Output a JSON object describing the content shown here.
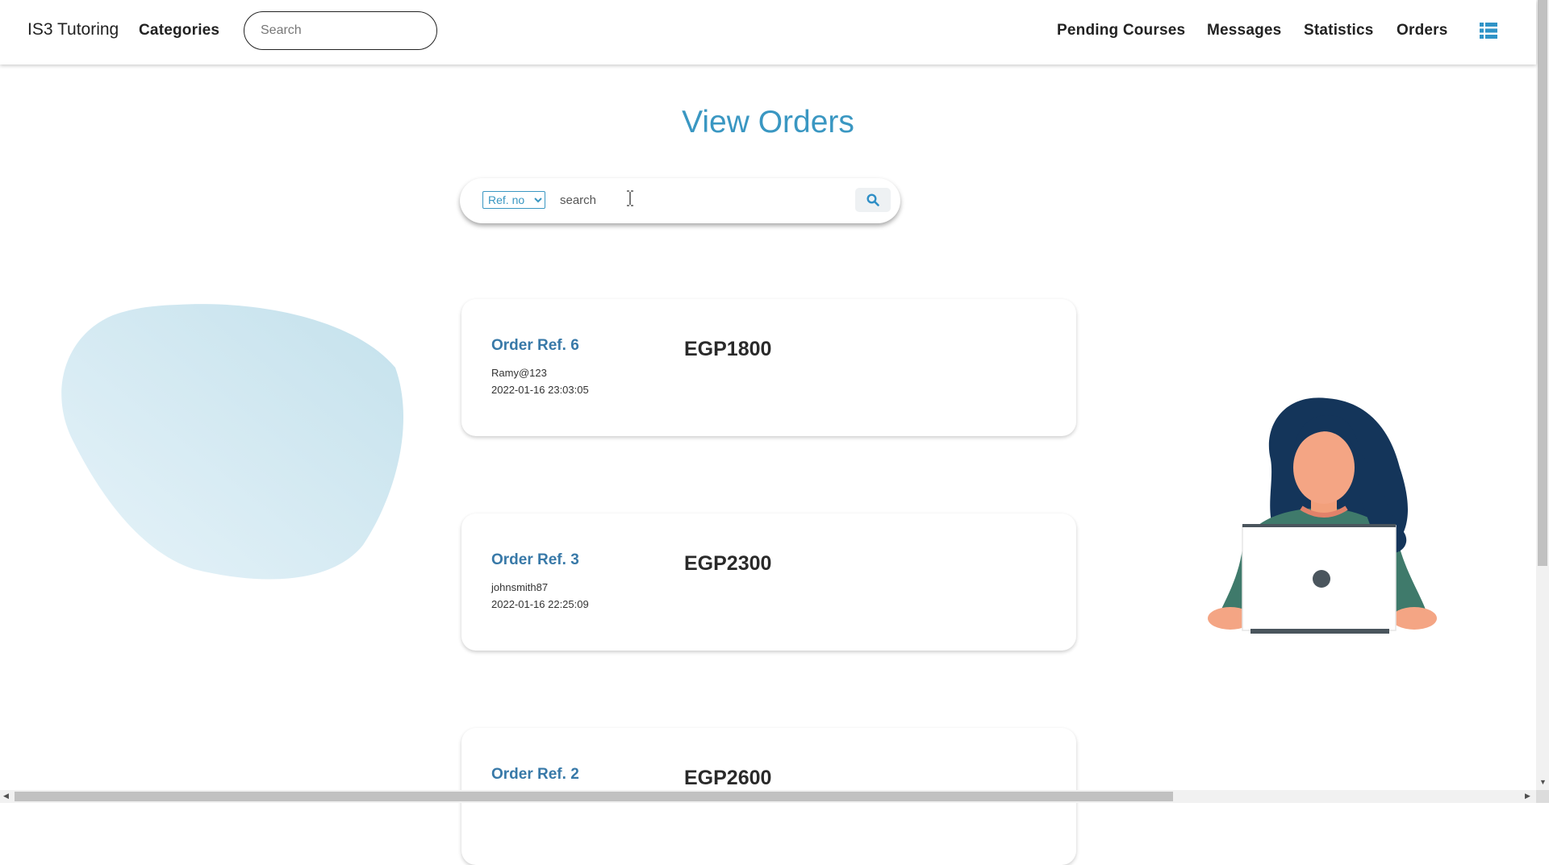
{
  "navbar": {
    "brand": "IS3 Tutoring",
    "categories": "Categories",
    "search_placeholder": "Search",
    "links": [
      "Pending Courses",
      "Messages",
      "Statistics",
      "Orders"
    ],
    "menu_icon": "list-icon"
  },
  "page": {
    "title": "View Orders"
  },
  "order_search": {
    "filter_selected": "Ref. no",
    "placeholder": "search",
    "button_icon": "search-icon"
  },
  "orders": [
    {
      "ref": "Order Ref. 6",
      "user": "Ramy@123",
      "date": "2022-01-16 23:03:05",
      "price": "EGP1800"
    },
    {
      "ref": "Order Ref. 3",
      "user": "johnsmith87",
      "date": "2022-01-16 22:25:09",
      "price": "EGP2300"
    },
    {
      "ref": "Order Ref. 2",
      "user": "",
      "date": "",
      "price": "EGP2600"
    }
  ],
  "colors": {
    "accent": "#3a97c2",
    "link": "#3879a8"
  }
}
